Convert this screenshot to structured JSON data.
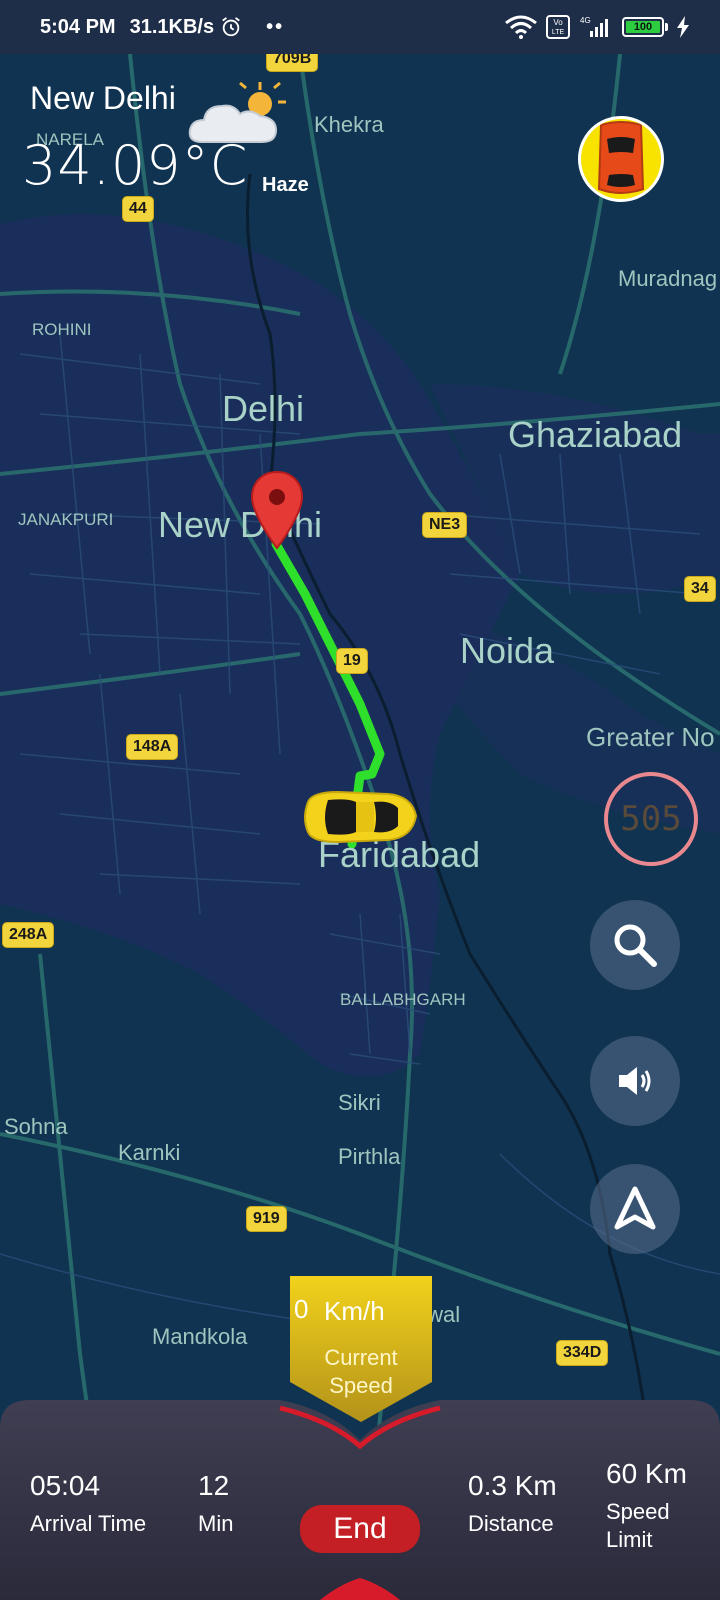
{
  "status_bar": {
    "time": "5:04 PM",
    "net_speed": "31.1KB/s",
    "dots": "••",
    "battery": "100",
    "volte": "Vo LTE",
    "network": "4G"
  },
  "weather": {
    "city": "New Delhi",
    "temperature": "34.09°C",
    "condition": "Haze"
  },
  "map": {
    "cities": [
      "Delhi",
      "Ghaziabad",
      "New Delhi",
      "Noida",
      "Faridabad"
    ],
    "towns": [
      "Khekra",
      "NARELA",
      "Muradnag",
      "ROHINI",
      "JANAKPURI",
      "Greater No",
      "BALLABHGARH",
      "Sikri",
      "Sohna",
      "Karnki",
      "Pirthla",
      "Mandkola",
      "alwal"
    ],
    "shields": [
      "709B",
      "44",
      "NE3",
      "34",
      "19",
      "148A",
      "248A",
      "919",
      "334D"
    ],
    "route_color": "#2ee02b",
    "destination_marker": "map-pin"
  },
  "speed_limit_sign": "505",
  "current_speed": {
    "value": "0",
    "unit": "Km/h",
    "caption_line1": "Current",
    "caption_line2": "Speed"
  },
  "trip": {
    "arrival_time": "05:04",
    "arrival_label": "Arrival Time",
    "duration": "12",
    "duration_label": "Min",
    "end_label": "End",
    "distance": "0.3 Km",
    "distance_label": "Distance",
    "speed_limit": "60 Km",
    "speed_limit_label_1": "Speed",
    "speed_limit_label_2": "Limit"
  },
  "colors": {
    "map_bg": "#0f3350",
    "panel_bg": "#3b3b4f",
    "end_button": "#c41f24",
    "badge": "#e6c21a"
  }
}
